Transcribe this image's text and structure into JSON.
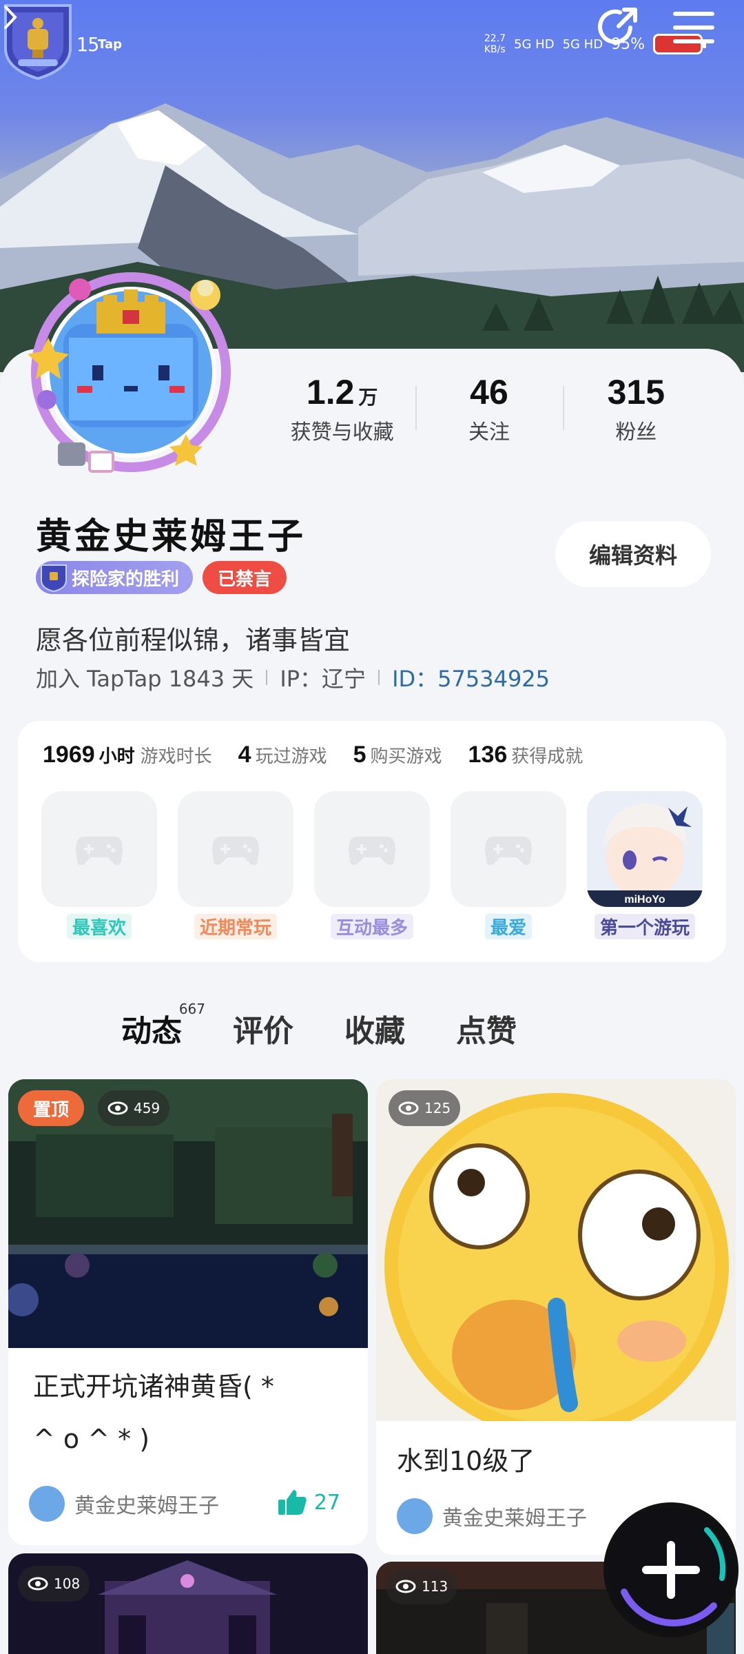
{
  "status_bar": {
    "time": "03:15",
    "app_badge": "Tap",
    "net_speed": "22.7",
    "net_unit": "KB/s",
    "sim1": "5G HD",
    "sim2": "5G HD",
    "battery": "95%"
  },
  "header": {
    "back_icon": "chevron-left-icon",
    "share_icon": "share-icon",
    "menu_icon": "menu-icon"
  },
  "profile": {
    "stats": [
      {
        "value": "1.2",
        "unit": "万",
        "label": "获赞与收藏"
      },
      {
        "value": "46",
        "unit": "",
        "label": "关注"
      },
      {
        "value": "315",
        "unit": "",
        "label": "粉丝"
      }
    ],
    "name": "黄金史莱姆王子",
    "edit_label": "编辑资料",
    "achievement_tag": "探险家的胜利",
    "muted_tag": "已禁言",
    "bio": "愿各位前程似锦，诸事皆宜",
    "joined": "加入 TapTap 1843 天",
    "ip": "IP：辽宁",
    "uid": "ID：57534925"
  },
  "game_stats": {
    "hours_value": "1969",
    "hours_unit": "小时",
    "hours_label": "游戏时长",
    "played_value": "4",
    "played_label": "玩过游戏",
    "bought_value": "5",
    "bought_label": "购买游戏",
    "achievements_value": "136",
    "achievements_label": "获得成就",
    "slots": [
      {
        "label": "最喜欢",
        "color": "#2ec7b8",
        "bg": "#e4f7f4"
      },
      {
        "label": "近期常玩",
        "color": "#f08a5a",
        "bg": "#fdeee6"
      },
      {
        "label": "互动最多",
        "color": "#9a8de0",
        "bg": "#efedfb"
      },
      {
        "label": "最爱",
        "color": "#39a9e0",
        "bg": "#e4f3fb"
      },
      {
        "label": "第一个游玩",
        "color": "#4a4a9a",
        "bg": "#ebeaf6"
      }
    ],
    "first_game_brand": "miHoYo"
  },
  "tabs": [
    {
      "label": "动态",
      "count": "667"
    },
    {
      "label": "评价",
      "count": ""
    },
    {
      "label": "收藏",
      "count": ""
    },
    {
      "label": "点赞",
      "count": ""
    }
  ],
  "posts": [
    {
      "pinned": "置顶",
      "views": "459",
      "title_line1": "正式开坑诸神黄昏( *",
      "title_line2": "^ o ^ * )",
      "author": "黄金史莱姆王子",
      "likes": "27"
    },
    {
      "views": "125",
      "title_line1": "水到10级了",
      "author": "黄金史莱姆王子"
    },
    {
      "views": "108"
    },
    {
      "views": "113"
    }
  ],
  "fab_icon": "plus-icon"
}
